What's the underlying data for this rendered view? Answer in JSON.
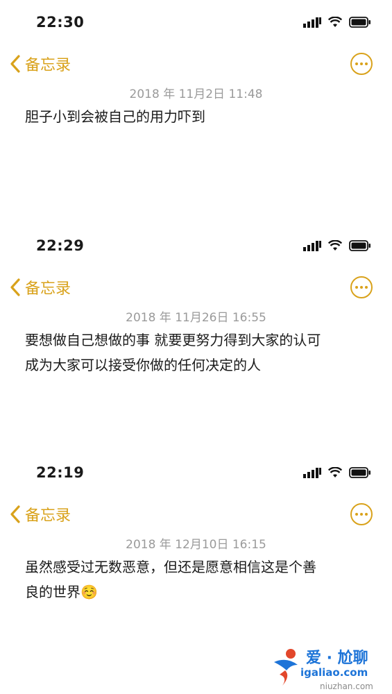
{
  "notes": [
    {
      "status_time": "22:30",
      "back_label": "备忘录",
      "date": "2018 年 11月2日 11:48",
      "lines": [
        "胆子小到会被自己的用力吓到"
      ]
    },
    {
      "status_time": "22:29",
      "back_label": "备忘录",
      "date": "2018 年 11月26日 16:55",
      "lines": [
        "要想做自己想做的事 就要更努力得到大家的认可",
        "成为大家可以接受你做的任何决定的人"
      ]
    },
    {
      "status_time": "22:19",
      "back_label": "备忘录",
      "date": "2018 年 12月10日 16:15",
      "lines": [
        "虽然感受过无数恶意，但还是愿意相信这是个善",
        "良的世界☺️"
      ]
    }
  ],
  "watermark": {
    "title": "爱 · 尬聊",
    "url": "igaliao.com",
    "url2": "niuzhan.com"
  },
  "colors": {
    "accent": "#d9a21b",
    "date": "#9a9a9a",
    "watermark": "#1d74d8"
  },
  "icons": [
    "signal-icon",
    "wifi-icon",
    "battery-icon",
    "back-chevron-icon",
    "more-options-icon"
  ]
}
